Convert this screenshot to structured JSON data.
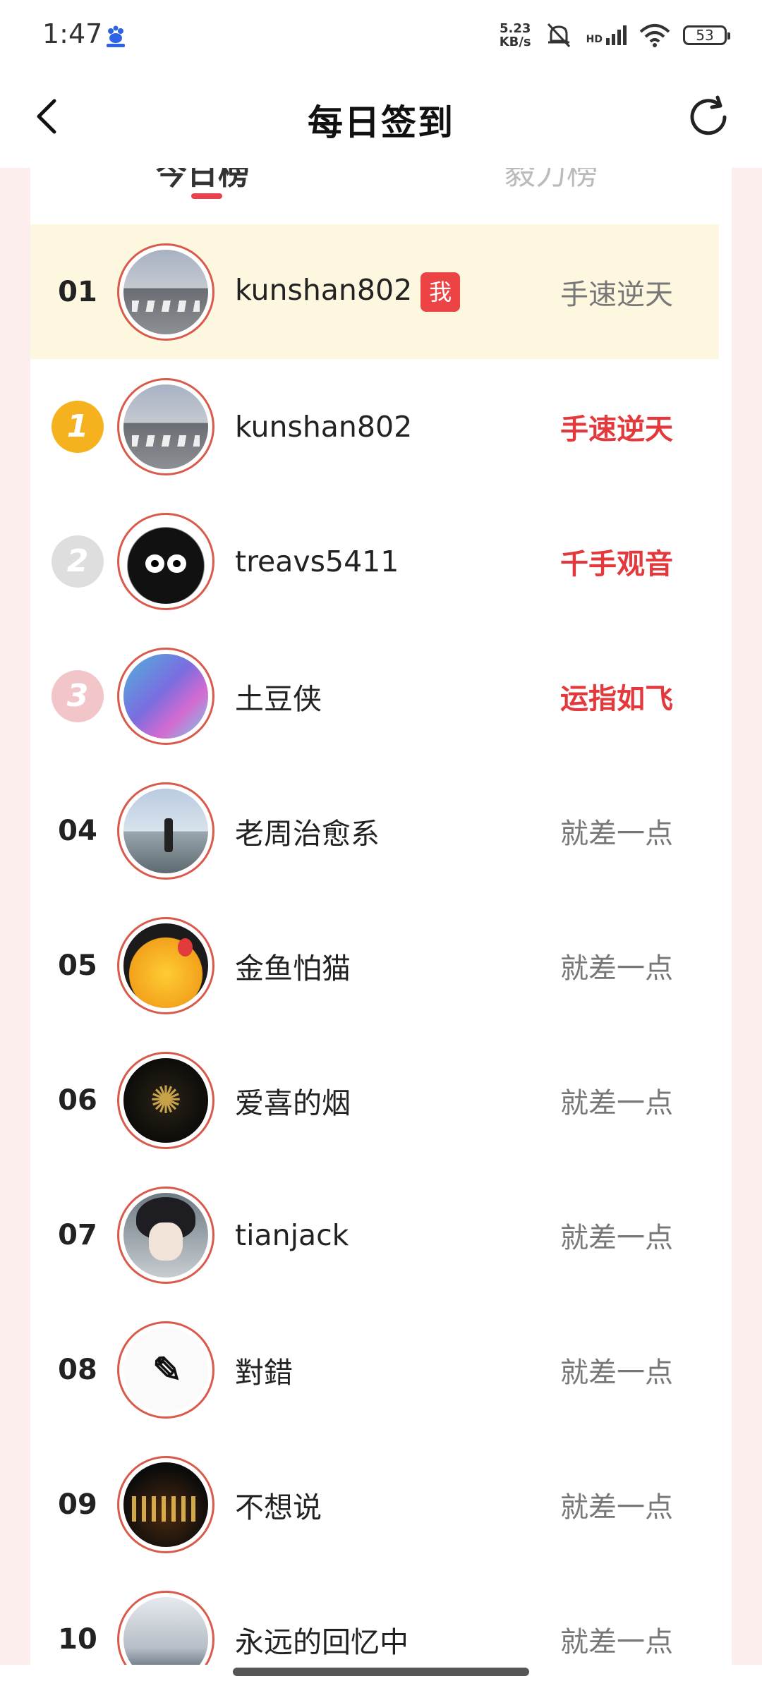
{
  "status_bar": {
    "time": "1:47",
    "net_speed_value": "5.23",
    "net_speed_unit": "KB/s",
    "signal_label": "HD",
    "battery": "53"
  },
  "header": {
    "title": "每日签到"
  },
  "tabs": [
    {
      "label": "今日榜",
      "active": true
    },
    {
      "label": "毅力榜",
      "active": false
    }
  ],
  "rows": [
    {
      "rank": "01",
      "medal": "",
      "name": "kunshan802",
      "me_badge": "我",
      "tag": "手速逆天",
      "hot": false,
      "is_me": true
    },
    {
      "rank": "",
      "medal": "1",
      "name": "kunshan802",
      "me_badge": "",
      "tag": "手速逆天",
      "hot": true,
      "is_me": false
    },
    {
      "rank": "",
      "medal": "2",
      "name": "treavs5411",
      "me_badge": "",
      "tag": "千手观音",
      "hot": true,
      "is_me": false
    },
    {
      "rank": "",
      "medal": "3",
      "name": "土豆侠",
      "me_badge": "",
      "tag": "运指如飞",
      "hot": true,
      "is_me": false
    },
    {
      "rank": "04",
      "medal": "",
      "name": "老周治愈系",
      "me_badge": "",
      "tag": "就差一点",
      "hot": false,
      "is_me": false
    },
    {
      "rank": "05",
      "medal": "",
      "name": "金鱼怕猫",
      "me_badge": "",
      "tag": "就差一点",
      "hot": false,
      "is_me": false
    },
    {
      "rank": "06",
      "medal": "",
      "name": "爱喜的烟",
      "me_badge": "",
      "tag": "就差一点",
      "hot": false,
      "is_me": false
    },
    {
      "rank": "07",
      "medal": "",
      "name": "tianjack",
      "me_badge": "",
      "tag": "就差一点",
      "hot": false,
      "is_me": false
    },
    {
      "rank": "08",
      "medal": "",
      "name": "對錯",
      "me_badge": "",
      "tag": "就差一点",
      "hot": false,
      "is_me": false
    },
    {
      "rank": "09",
      "medal": "",
      "name": "不想说",
      "me_badge": "",
      "tag": "就差一点",
      "hot": false,
      "is_me": false
    },
    {
      "rank": "10",
      "medal": "",
      "name": "永远的回忆中",
      "me_badge": "",
      "tag": "就差一点",
      "hot": false,
      "is_me": false
    }
  ],
  "colors": {
    "accent": "#e4393c",
    "me_row_bg": "#fef7e0",
    "page_side_bg": "#fdeeee",
    "gold": "#f6b11f",
    "silver": "#dedede",
    "bronze": "#f2c6c9"
  },
  "icons": {
    "back": "chevron-left-icon",
    "refresh": "refresh-icon"
  }
}
